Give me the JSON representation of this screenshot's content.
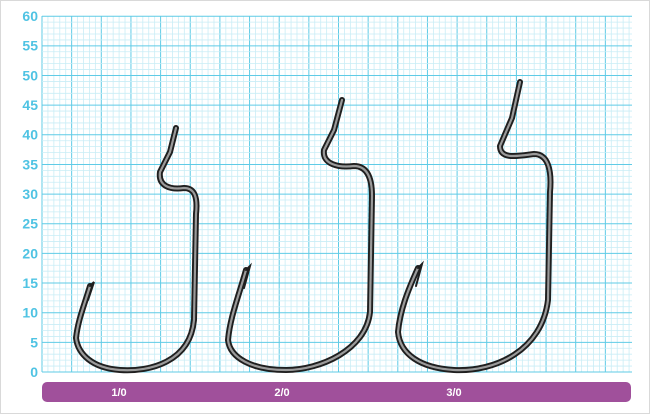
{
  "figure": {
    "y_axis_ticks": [
      "60",
      "55",
      "50",
      "45",
      "40",
      "35",
      "30",
      "25",
      "20",
      "15",
      "10",
      "5",
      "0"
    ],
    "size_labels": [
      "1/0",
      "2/0",
      "3/0"
    ],
    "colors": {
      "grid_minor": "#c9edf6",
      "grid_major": "#5fcbe6",
      "tick_label": "#4fc3e3",
      "size_bar": "#a0509b",
      "size_label": "#ffffff",
      "hook_dark": "#1f1f1f",
      "hook_light": "#9a9a9a"
    }
  }
}
